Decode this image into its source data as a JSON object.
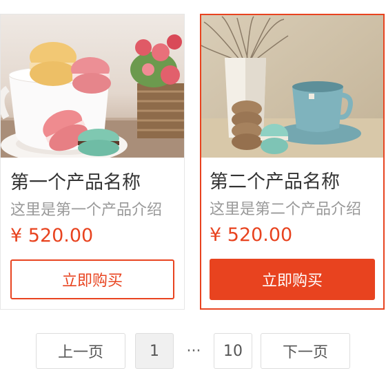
{
  "products": [
    {
      "name": "第一个产品名称",
      "description": "这里是第一个产品介绍",
      "price": "¥ 520.00",
      "buy_label": "立即购买",
      "image_icon": "macarons-teacup-photo"
    },
    {
      "name": "第二个产品名称",
      "description": "这里是第二个产品介绍",
      "price": "¥ 520.00",
      "buy_label": "立即购买",
      "image_icon": "vase-cup-macarons-photo",
      "selected": true
    }
  ],
  "pagination": {
    "prev_label": "上一页",
    "current_page": "1",
    "ellipsis": "···",
    "last_page": "10",
    "next_label": "下一页"
  },
  "colors": {
    "accent": "#e8431f",
    "title": "#333333",
    "description": "#999999",
    "border": "#e6e6e6"
  }
}
